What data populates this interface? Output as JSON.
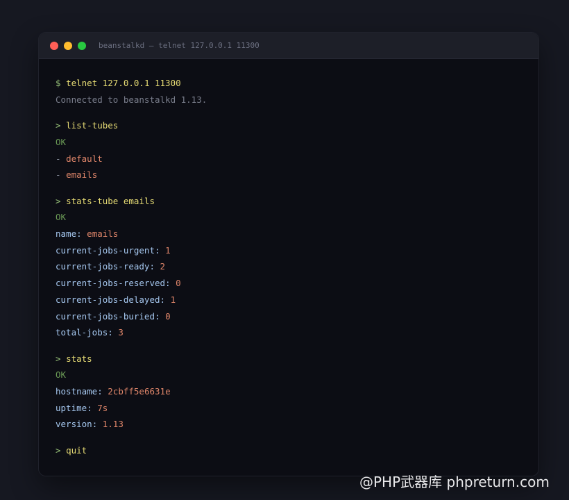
{
  "window": {
    "title": "beanstalkd — telnet 127.0.0.1 11300"
  },
  "terminal": {
    "start_prompt": "$",
    "start_command": "telnet 127.0.0.1 11300",
    "connected_message": "Connected to beanstalkd 1.13.",
    "prompt": ">",
    "blocks": {
      "list_tubes": {
        "command": "list-tubes",
        "status": "OK",
        "items": [
          "default",
          "emails"
        ]
      },
      "stats_tube": {
        "command": "stats-tube emails",
        "status": "OK",
        "fields": [
          {
            "key": "name",
            "value": "emails"
          },
          {
            "key": "current-jobs-urgent",
            "value": "1"
          },
          {
            "key": "current-jobs-ready",
            "value": "2"
          },
          {
            "key": "current-jobs-reserved",
            "value": "0"
          },
          {
            "key": "current-jobs-delayed",
            "value": "1"
          },
          {
            "key": "current-jobs-buried",
            "value": "0"
          },
          {
            "key": "total-jobs",
            "value": "3"
          }
        ]
      },
      "stats": {
        "command": "stats",
        "status": "OK",
        "fields": [
          {
            "key": "hostname",
            "value": "2cbff5e6631e"
          },
          {
            "key": "uptime",
            "value": "7s"
          },
          {
            "key": "version",
            "value": "1.13"
          }
        ]
      },
      "quit": {
        "command": "quit"
      }
    },
    "list_dash": "-"
  },
  "watermark": "@PHP武器库 phpreturn.com",
  "colors": {
    "background": "#161821",
    "terminal_bg": "#0c0d14",
    "titlebar_bg": "#1d1f28",
    "prompt": "#98c379",
    "command": "#e6db74",
    "ok": "#6a9955",
    "value": "#e0866a",
    "key": "#a6c8f0",
    "dim": "#7a7e8c"
  }
}
